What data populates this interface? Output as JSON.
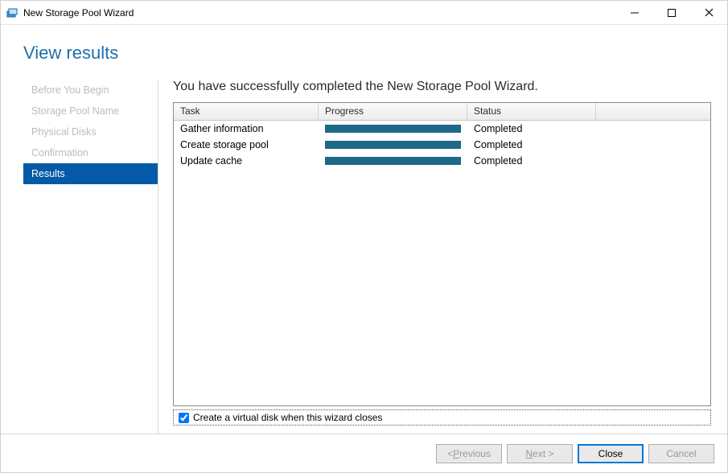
{
  "window": {
    "title": "New Storage Pool Wizard"
  },
  "page": {
    "heading": "View results"
  },
  "sidebar": {
    "items": [
      {
        "label": "Before You Begin",
        "active": false
      },
      {
        "label": "Storage Pool Name",
        "active": false
      },
      {
        "label": "Physical Disks",
        "active": false
      },
      {
        "label": "Confirmation",
        "active": false
      },
      {
        "label": "Results",
        "active": true
      }
    ]
  },
  "main": {
    "heading": "You have successfully completed the New Storage Pool Wizard.",
    "columns": {
      "task": "Task",
      "progress": "Progress",
      "status": "Status"
    },
    "rows": [
      {
        "task": "Gather information",
        "status": "Completed"
      },
      {
        "task": "Create storage pool",
        "status": "Completed"
      },
      {
        "task": "Update cache",
        "status": "Completed"
      }
    ],
    "checkbox_label": "Create a virtual disk when this wizard closes",
    "checkbox_checked": true
  },
  "footer": {
    "previous": "< Previous",
    "next": "Next >",
    "close": "Close",
    "cancel": "Cancel"
  }
}
